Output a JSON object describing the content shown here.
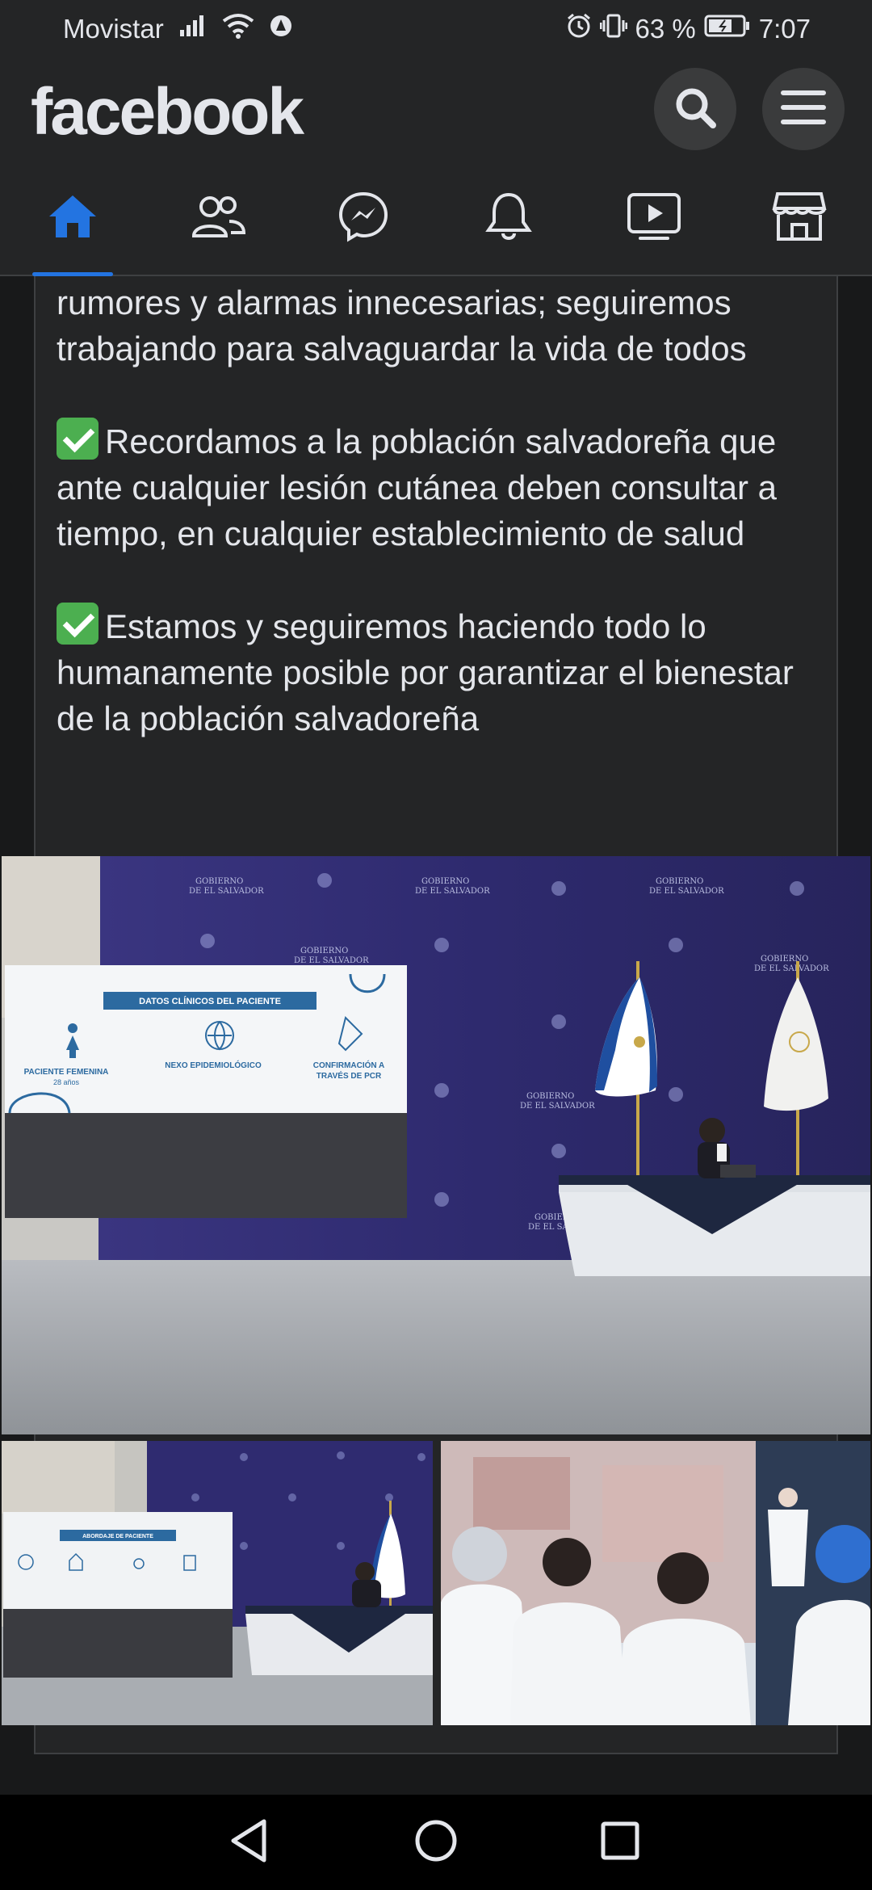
{
  "status_bar": {
    "carrier": "Movistar",
    "battery_percent": "63 %",
    "time": "7:07"
  },
  "header": {
    "logo": "facebook",
    "search_icon": "search-icon",
    "menu_icon": "hamburger-menu-icon"
  },
  "tabs": [
    {
      "name": "home",
      "icon": "home-icon",
      "active": true
    },
    {
      "name": "friends",
      "icon": "friends-icon",
      "active": false
    },
    {
      "name": "messenger",
      "icon": "messenger-icon",
      "active": false
    },
    {
      "name": "notifications",
      "icon": "bell-icon",
      "active": false
    },
    {
      "name": "watch",
      "icon": "video-icon",
      "active": false
    },
    {
      "name": "marketplace",
      "icon": "shop-icon",
      "active": false
    }
  ],
  "post": {
    "paragraph_1": "rumores y alarmas innecesarias; seguiremos trabajando para salvaguardar la vida de todos",
    "paragraph_2": "Recordamos a la población salvadoreña que ante cualquier lesión cutánea deben consultar a tiempo, en cualquier establecimiento de salud",
    "paragraph_3": "Estamos y seguiremos haciendo todo lo humanamente posible por garantizar  el bienestar de la población salvadoreña"
  },
  "photo_main": {
    "screen_title": "DATOS CLÍNICOS DEL PACIENTE",
    "item_1": "PACIENTE FEMENINA",
    "item_1_sub": "28 años",
    "item_2": "NEXO EPIDEMIOLÓGICO",
    "item_3_line1": "CONFIRMACIÓN A",
    "item_3_line2": "TRAVÉS DE PCR",
    "backdrop_text_1": "GOBIERNO",
    "backdrop_text_2": "DE EL SALVADOR"
  },
  "photo_left": {
    "screen_title": "ABORDAJE DE PACIENTE"
  },
  "colors": {
    "background": "#18191a",
    "card": "#242526",
    "accent": "#2374e1",
    "text": "#e4e6eb"
  }
}
